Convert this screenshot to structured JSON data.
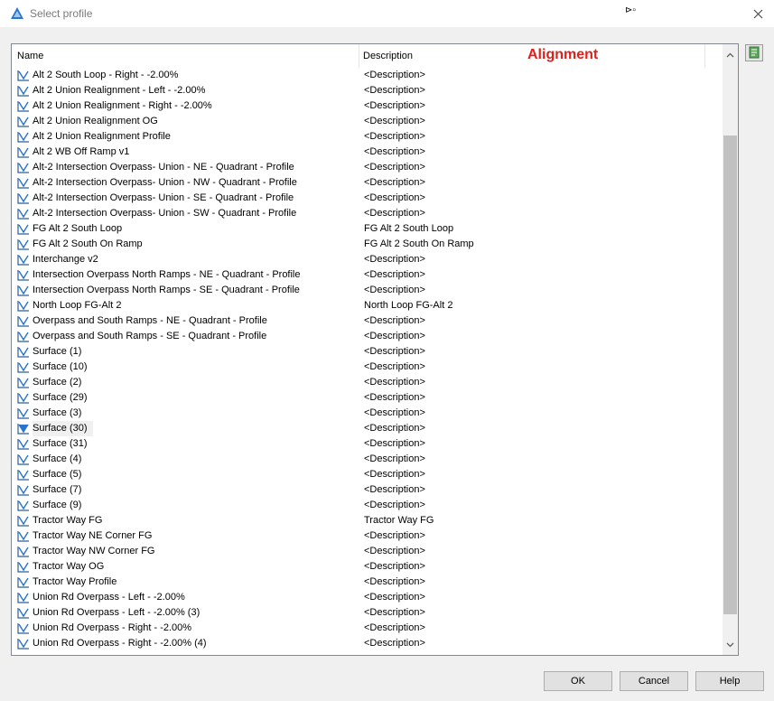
{
  "window": {
    "title": "Select profile",
    "accent_color": "#1e6fc7"
  },
  "header": {
    "name_label": "Name",
    "description_label": "Description",
    "alignment_label": "Alignment",
    "alignment_color": "#e0201b"
  },
  "profiles": [
    {
      "name": "Alt 2 South Loop - Right - -2.00%",
      "description": "<Description>"
    },
    {
      "name": "Alt 2 Union Realignment - Left - -2.00%",
      "description": "<Description>"
    },
    {
      "name": "Alt 2 Union Realignment - Right - -2.00%",
      "description": "<Description>"
    },
    {
      "name": "Alt 2 Union Realignment OG",
      "description": "<Description>"
    },
    {
      "name": "Alt 2 Union Realignment Profile",
      "description": "<Description>"
    },
    {
      "name": "Alt 2 WB Off Ramp v1",
      "description": "<Description>"
    },
    {
      "name": "Alt-2 Intersection Overpass- Union - NE - Quadrant - Profile",
      "description": "<Description>"
    },
    {
      "name": "Alt-2 Intersection Overpass- Union - NW - Quadrant - Profile",
      "description": "<Description>"
    },
    {
      "name": "Alt-2 Intersection Overpass- Union - SE - Quadrant - Profile",
      "description": "<Description>"
    },
    {
      "name": "Alt-2 Intersection Overpass- Union - SW - Quadrant - Profile",
      "description": "<Description>"
    },
    {
      "name": "FG Alt 2 South Loop",
      "description": "FG Alt 2 South Loop"
    },
    {
      "name": "FG Alt 2 South On Ramp",
      "description": "FG Alt 2 South On Ramp"
    },
    {
      "name": "Interchange v2",
      "description": "<Description>"
    },
    {
      "name": "Intersection Overpass North Ramps - NE - Quadrant - Profile",
      "description": "<Description>"
    },
    {
      "name": "Intersection Overpass North Ramps - SE - Quadrant - Profile",
      "description": "<Description>"
    },
    {
      "name": "North Loop FG-Alt 2",
      "description": "North Loop FG-Alt 2"
    },
    {
      "name": "Overpass and South Ramps - NE - Quadrant - Profile",
      "description": "<Description>"
    },
    {
      "name": "Overpass and South Ramps - SE - Quadrant - Profile",
      "description": "<Description>"
    },
    {
      "name": "Surface (1)",
      "description": "<Description>"
    },
    {
      "name": "Surface (10)",
      "description": "<Description>"
    },
    {
      "name": "Surface (2)",
      "description": "<Description>"
    },
    {
      "name": "Surface (29)",
      "description": "<Description>"
    },
    {
      "name": "Surface (3)",
      "description": "<Description>"
    },
    {
      "name": "Surface (30)",
      "description": "<Description>",
      "selected": true
    },
    {
      "name": "Surface (31)",
      "description": "<Description>"
    },
    {
      "name": "Surface (4)",
      "description": "<Description>"
    },
    {
      "name": "Surface (5)",
      "description": "<Description>"
    },
    {
      "name": "Surface (7)",
      "description": "<Description>"
    },
    {
      "name": "Surface (9)",
      "description": "<Description>"
    },
    {
      "name": "Tractor Way FG",
      "description": "Tractor Way FG"
    },
    {
      "name": "Tractor Way NE Corner FG",
      "description": "<Description>"
    },
    {
      "name": "Tractor Way NW Corner FG",
      "description": "<Description>"
    },
    {
      "name": "Tractor Way OG",
      "description": "<Description>"
    },
    {
      "name": "Tractor Way Profile",
      "description": "<Description>"
    },
    {
      "name": "Union Rd Overpass - Left - -2.00%",
      "description": "<Description>"
    },
    {
      "name": "Union Rd Overpass - Left - -2.00% (3)",
      "description": "<Description>"
    },
    {
      "name": "Union Rd Overpass - Right - -2.00%",
      "description": "<Description>"
    },
    {
      "name": "Union Rd Overpass - Right - -2.00% (4)",
      "description": "<Description>"
    }
  ],
  "icons": {
    "profile": "profile-icon",
    "pick": "pick-from-drawing-icon",
    "close": "close-icon"
  },
  "buttons": {
    "ok": "OK",
    "cancel": "Cancel",
    "help": "Help"
  }
}
